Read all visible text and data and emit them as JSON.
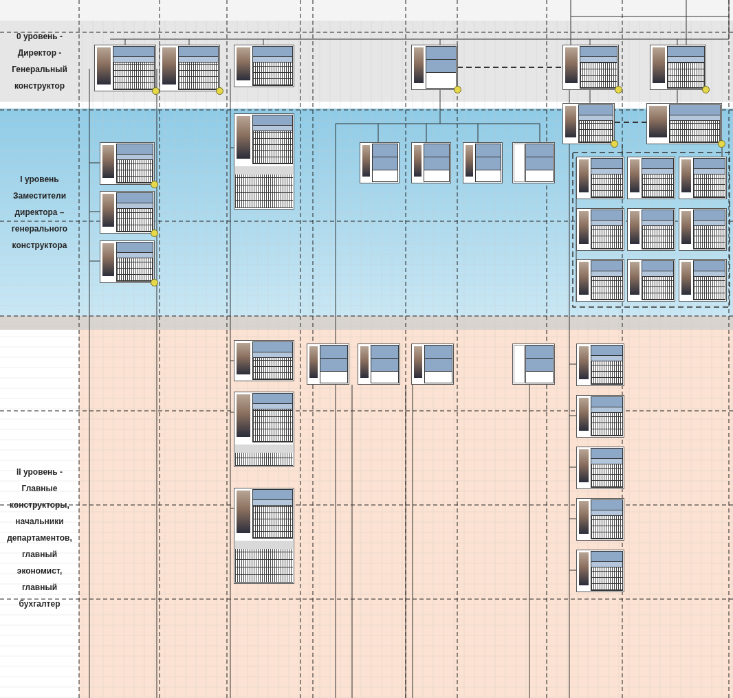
{
  "levels": [
    {
      "label": "0 уровень - Директор - Генеральный конструктор"
    },
    {
      "label": "I уровень Заместители директора – генерального конструктора"
    },
    {
      "label": "II уровень - Главные конструкторы, начальники департаментов, главный экономист, главный бухгалтер"
    }
  ],
  "cards": [
    {
      "kind": "table",
      "photo": true,
      "badge": true
    },
    {
      "kind": "table",
      "photo": true,
      "badge": true
    },
    {
      "kind": "table",
      "photo": true,
      "badge": false
    },
    {
      "kind": "simple",
      "photo": true,
      "badge": true
    },
    {
      "kind": "table",
      "photo": true,
      "badge": true
    },
    {
      "kind": "table",
      "photo": true,
      "badge": true
    },
    {
      "kind": "table",
      "photo": true,
      "badge": true
    },
    {
      "kind": "table",
      "photo": true,
      "badge": true
    },
    {
      "kind": "note",
      "photo": true,
      "badge": false
    },
    {
      "kind": "table",
      "photo": true,
      "badge": true
    },
    {
      "kind": "table",
      "photo": true,
      "badge": true
    },
    {
      "kind": "table",
      "photo": true,
      "badge": true
    },
    {
      "kind": "simple",
      "photo": true,
      "badge": false
    },
    {
      "kind": "simple",
      "photo": true,
      "badge": false
    },
    {
      "kind": "simple",
      "photo": true,
      "badge": false
    },
    {
      "kind": "simple",
      "photo": false,
      "badge": false
    },
    {
      "kind": "table",
      "photo": true,
      "badge": false
    },
    {
      "kind": "table",
      "photo": true,
      "badge": false
    },
    {
      "kind": "table",
      "photo": true,
      "badge": false
    },
    {
      "kind": "table",
      "photo": true,
      "badge": false
    },
    {
      "kind": "table",
      "photo": true,
      "badge": false
    },
    {
      "kind": "table",
      "photo": true,
      "badge": false
    },
    {
      "kind": "table",
      "photo": true,
      "badge": false
    },
    {
      "kind": "table",
      "photo": true,
      "badge": false
    },
    {
      "kind": "table",
      "photo": true,
      "badge": false
    },
    {
      "kind": "table",
      "photo": true,
      "badge": false
    },
    {
      "kind": "simple",
      "photo": true,
      "badge": false
    },
    {
      "kind": "simple",
      "photo": true,
      "badge": false
    },
    {
      "kind": "simple",
      "photo": true,
      "badge": false
    },
    {
      "kind": "simple",
      "photo": false,
      "badge": false
    },
    {
      "kind": "note",
      "photo": true,
      "badge": false
    },
    {
      "kind": "note",
      "photo": true,
      "badge": false
    },
    {
      "kind": "table",
      "photo": true,
      "badge": false
    },
    {
      "kind": "table",
      "photo": true,
      "badge": false
    },
    {
      "kind": "table",
      "photo": true,
      "badge": false
    },
    {
      "kind": "table",
      "photo": true,
      "badge": false
    },
    {
      "kind": "table",
      "photo": true,
      "badge": false
    }
  ]
}
